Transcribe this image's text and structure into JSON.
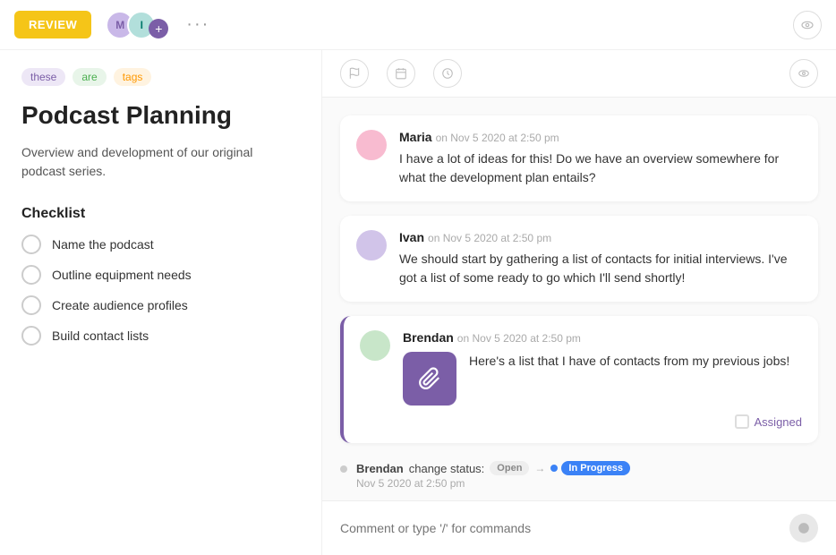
{
  "toolbar": {
    "review_label": "REVIEW",
    "more_label": "···"
  },
  "tags": [
    {
      "id": "tag-these",
      "label": "these",
      "color_class": "tag-purple"
    },
    {
      "id": "tag-are",
      "label": "are",
      "color_class": "tag-green"
    },
    {
      "id": "tag-tags",
      "label": "tags",
      "color_class": "tag-orange"
    }
  ],
  "page": {
    "title": "Podcast Planning",
    "description": "Overview and development of our original podcast series."
  },
  "checklist": {
    "title": "Checklist",
    "items": [
      {
        "id": "item-1",
        "label": "Name the podcast"
      },
      {
        "id": "item-2",
        "label": "Outline equipment needs"
      },
      {
        "id": "item-3",
        "label": "Create audience profiles"
      },
      {
        "id": "item-4",
        "label": "Build contact lists"
      }
    ]
  },
  "comments": [
    {
      "id": "comment-maria",
      "author": "Maria",
      "meta": "on Nov 5 2020 at 2:50 pm",
      "text": "I have a lot of ideas for this! Do we have an overview somewhere for what the development plan entails?"
    },
    {
      "id": "comment-ivan",
      "author": "Ivan",
      "meta": "on Nov 5 2020 at 2:50 pm",
      "text": "We should start by gathering a list of contacts for initial interviews. I've got a list of some ready to go which I'll send shortly!"
    }
  ],
  "brendan_comment": {
    "author": "Brendan",
    "meta": "on Nov 5 2020 at 2:50 pm",
    "text": "Here's a list that I have of contacts from my previous jobs!",
    "assigned_label": "Assigned"
  },
  "status_change": {
    "author": "Brendan",
    "action": "change status:",
    "from": "Open",
    "to": "In Progress",
    "time": "Nov 5 2020 at 2:50 pm"
  },
  "comment_input": {
    "placeholder": "Comment or type '/' for commands"
  },
  "icons": {
    "flag": "⚑",
    "calendar": "▭",
    "clock": "◷",
    "eye": "◉",
    "paperclip": "🖇",
    "arrow": "→",
    "send": "➤"
  }
}
